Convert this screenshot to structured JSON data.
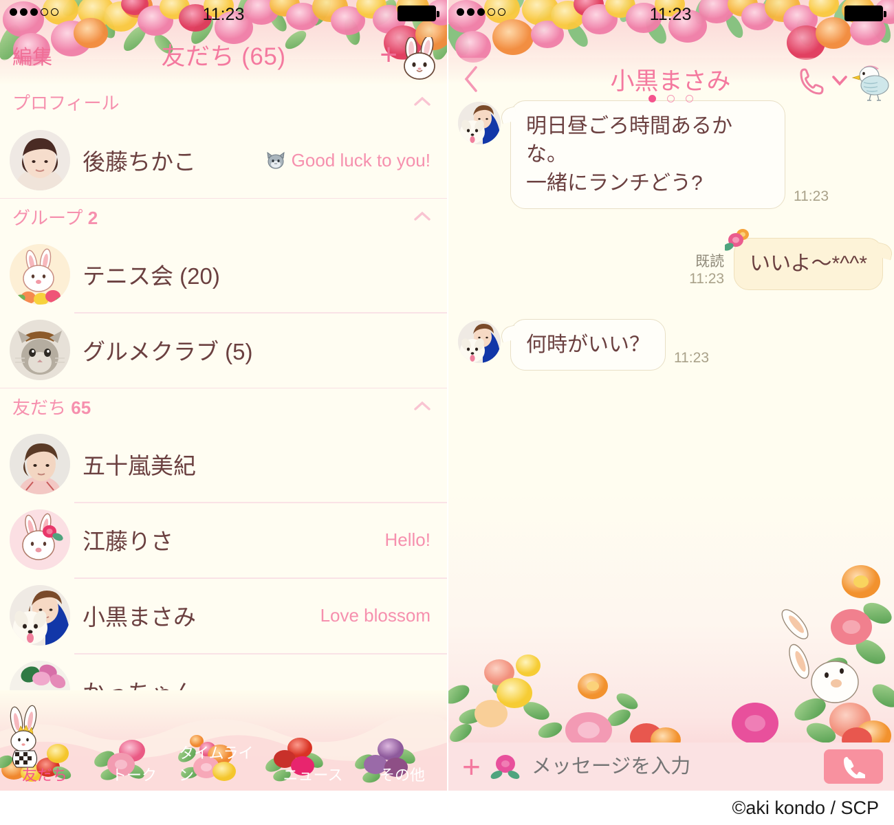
{
  "theme": {
    "accent_pink": "#f4799f",
    "deep_pink": "#f4548d",
    "name_brown": "#6b4040",
    "list_bg": "#fffdf2",
    "chat_bg": "#fffdf0",
    "bubble_in": "#fffef9",
    "bubble_out": "#fdf3d8",
    "input_bar_bg": "#fbe2e3",
    "call_button_bg": "#f8919f"
  },
  "status_bar": {
    "signal_dots_filled": 3,
    "signal_dots_total": 5,
    "time": "11:23",
    "battery_full": true
  },
  "friends_screen": {
    "nav": {
      "edit_label": "編集",
      "title": "友だち (65)",
      "add_icon": "plus-icon",
      "bunny_icon": "bunny-face-icon"
    },
    "sections": [
      {
        "label": "プロフィール",
        "count": "",
        "chevron": "chevron-up-icon",
        "rows": [
          {
            "name": "後藤ちかこ",
            "status": "Good luck to you!",
            "status_icon": "cat-face-icon",
            "avatar": "photo-woman-short-hair"
          }
        ]
      },
      {
        "label": "グループ",
        "count": "2",
        "chevron": "chevron-up-icon",
        "rows": [
          {
            "name": "テニス会 (20)",
            "status": "",
            "status_icon": "",
            "avatar": "illustration-bunny-roses"
          },
          {
            "name": "グルメクラブ (5)",
            "status": "",
            "status_icon": "",
            "avatar": "photo-tabby-cat"
          }
        ]
      },
      {
        "label": "友だち",
        "count": "65",
        "chevron": "chevron-up-icon",
        "rows": [
          {
            "name": "五十嵐美紀",
            "status": "",
            "status_icon": "",
            "avatar": "photo-woman-bob"
          },
          {
            "name": "江藤りさ",
            "status": "Hello!",
            "status_icon": "",
            "avatar": "illustration-bunny-rose-pink"
          },
          {
            "name": "小黒まさみ",
            "status": "Love blossom",
            "status_icon": "",
            "avatar": "photo-woman-with-dog"
          },
          {
            "name": "かっちゃん",
            "status": "",
            "status_icon": "",
            "avatar": "illustration-bunny-flowers"
          }
        ]
      }
    ],
    "tabbar": [
      {
        "label": "友だち",
        "icon": "bunny-king-roses-icon",
        "active": true
      },
      {
        "label": "トーク",
        "icon": "pink-rose-icon",
        "active": false
      },
      {
        "label": "タイムライン",
        "icon": "orange-rose-bouquet-icon",
        "active": false
      },
      {
        "label": "ニュース",
        "icon": "red-rose-icon",
        "active": false
      },
      {
        "label": "その他",
        "icon": "purple-rose-icon",
        "active": false
      }
    ]
  },
  "chat_screen": {
    "nav": {
      "back_icon": "chevron-left-icon",
      "title": "小黒まさみ",
      "call_icon": "phone-handset-icon",
      "menu_icon": "chevron-down-icon",
      "bird_icon": "watercolor-bird-icon",
      "page_dots_total": 3,
      "page_dots_active_index": 0
    },
    "messages": [
      {
        "side": "in",
        "avatar": "photo-woman-with-dog",
        "lines": [
          "明日昼ごろ時間あるかな。",
          "一緒にランチどう?"
        ],
        "time": "11:23",
        "read_label": ""
      },
      {
        "side": "out",
        "avatar": "",
        "lines": [
          "いいよ〜*^^*"
        ],
        "time": "11:23",
        "read_label": "既読",
        "decor_icon": "rose-sticker-icon"
      },
      {
        "side": "in",
        "avatar": "photo-woman-with-dog",
        "lines": [
          "何時がいい？"
        ],
        "time": "11:23",
        "read_label": ""
      }
    ],
    "input_bar": {
      "plus_icon": "plus-icon",
      "sticker_icon": "rose-sticker-icon",
      "placeholder": "メッセージを入力",
      "call_button_icon": "phone-handset-filled-icon"
    }
  },
  "footer": {
    "credit": "©aki kondo / SCP"
  }
}
